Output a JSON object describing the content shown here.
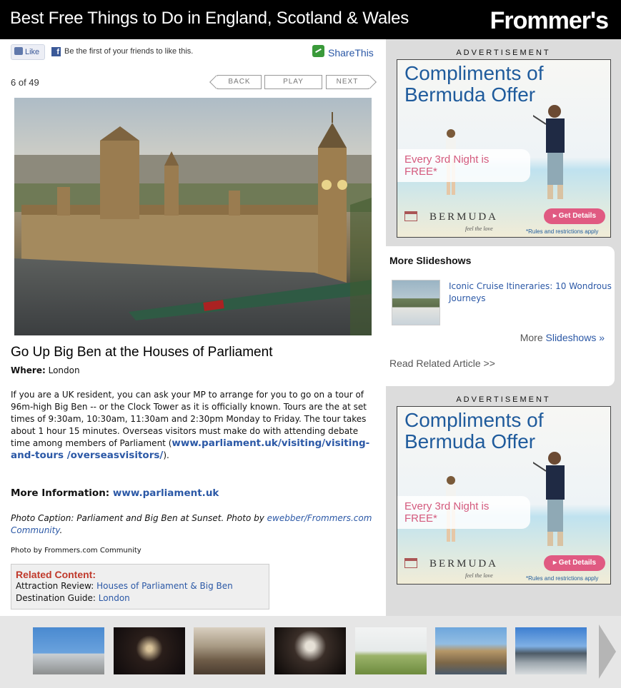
{
  "header": {
    "title": "Best Free Things to Do in England, Scotland & Wales",
    "logo": "Frommer's"
  },
  "social": {
    "like_label": "Like",
    "fb_text": "Be the first of your friends to like this.",
    "share_label": "ShareThis"
  },
  "slideshow": {
    "counter": "6 of 49",
    "back_label": "BACK",
    "play_label": "PLAY",
    "next_label": "NEXT"
  },
  "article": {
    "title": "Go Up Big Ben at the Houses of Parliament",
    "where_label": "Where:",
    "where_value": "London",
    "body": "If you are a UK resident, you can ask your MP to arrange for you to go on a tour of 96m-high Big Ben -- or the Clock Tower as it is officially known. Tours are the at set times of 9:30am, 10:30am, 11:30am and 2:30pm Monday to Friday. The tour takes about 1 hour 15 minutes. Overseas visitors must make do with attending debate time among members of Parliament (",
    "body_link": "www.parliament.uk/visiting/visiting-and-tours /overseasvisitors/",
    "body_end": ").",
    "more_info_label": "More Information:",
    "more_info_link": "www.parliament.uk",
    "caption_prefix": "Photo Caption: Parliament and Big Ben at Sunset. Photo by ",
    "caption_link": "ewebber/Frommers.com Community",
    "caption_suffix": ".",
    "photo_by": "Photo by Frommers.com Community"
  },
  "related": {
    "heading": "Related Content:",
    "rows": [
      {
        "label": "Attraction Review:",
        "link": "Houses of Parliament & Big Ben"
      },
      {
        "label": "Destination Guide:",
        "link": "London"
      }
    ]
  },
  "sidebar": {
    "ad_label": "ADVERTISEMENT",
    "ad": {
      "headline_1": "Compliments of",
      "headline_2": "Bermuda Offer",
      "offer": "Every 3rd Night is FREE*",
      "brand": "BERMUDA",
      "brand_tagline": "feel the love",
      "button": "▸ Get Details",
      "rules": "*Rules and restrictions apply"
    },
    "more_slideshows": {
      "heading": "More Slideshows",
      "item": "Iconic Cruise Itineraries: 10 Wondrous Journeys",
      "more_prefix": "More ",
      "more_link": "Slideshows »",
      "read_related": "Read Related Article >>"
    }
  },
  "colors": {
    "link": "#2b58a6",
    "header_bg": "#000000",
    "sidebar_bg": "#dcdcdc",
    "related_heading": "#c0392b",
    "ad_headline": "#1f5b9c",
    "ad_offer": "#d45a7d",
    "share_green": "#3a9a3a"
  }
}
